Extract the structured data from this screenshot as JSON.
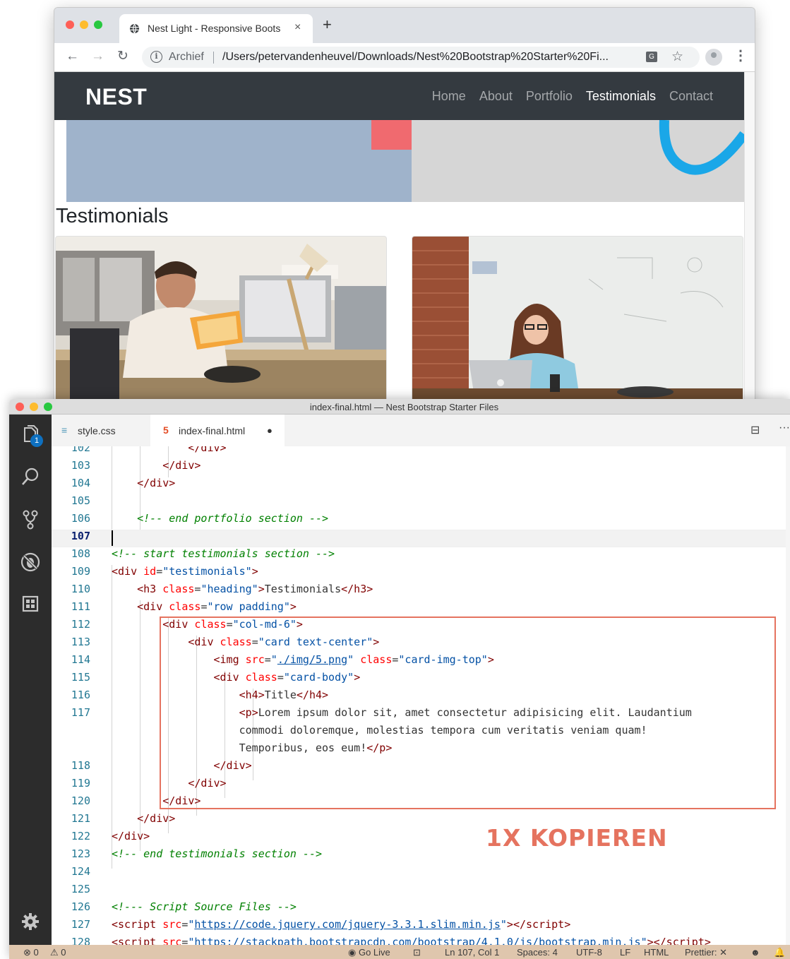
{
  "browser": {
    "tab_title": "Nest Light - Responsive Boots",
    "tab_close": "×",
    "new_tab": "+",
    "omnibox_label": "Archief",
    "url": "/Users/petervandenheuvel/Downloads/Nest%20Bootstrap%20Starter%20Fi...",
    "info_glyph": "i",
    "translate_glyph": "G",
    "star_glyph": "☆",
    "menu_glyph": "⋮"
  },
  "site": {
    "brand": "NEST",
    "nav": [
      "Home",
      "About",
      "Portfolio",
      "Testimonials",
      "Contact"
    ],
    "active_nav": "Testimonials",
    "heading": "Testimonials"
  },
  "vscode": {
    "window_title": "index-final.html — Nest Bootstrap Starter Files",
    "explorer_badge": "1",
    "tabs": [
      {
        "icon": "≡",
        "name": "style.css",
        "active": false
      },
      {
        "icon": "5",
        "name": "index-final.html",
        "active": true,
        "modified_marker": "●"
      }
    ],
    "editor_actions": [
      "⊟",
      "···"
    ],
    "current_line": "107",
    "lines": [
      {
        "num": "102",
        "html": "            &lt;/div&gt;"
      },
      {
        "num": "103",
        "html": "        &lt;/div&gt;"
      },
      {
        "num": "104",
        "html": "    &lt;/div&gt;"
      },
      {
        "num": "105",
        "html": ""
      },
      {
        "num": "106",
        "html": "    &lt;!-- end portfolio section --&gt;"
      },
      {
        "num": "107",
        "html": ""
      },
      {
        "num": "108",
        "html": "&lt;!-- start testimonials section --&gt;"
      },
      {
        "num": "109",
        "html": "&lt;div id=\"testimonials\"&gt;"
      },
      {
        "num": "110",
        "html": "    &lt;h3 class=\"heading\"&gt;Testimonials&lt;/h3&gt;"
      },
      {
        "num": "111",
        "html": "    &lt;div class=\"row padding\"&gt;"
      },
      {
        "num": "112",
        "html": "        &lt;div class=\"col-md-6\"&gt;"
      },
      {
        "num": "113",
        "html": "            &lt;div class=\"card text-center\"&gt;"
      },
      {
        "num": "114",
        "html": "                &lt;img src=\"./img/5.png\" class=\"card-img-top\"&gt;"
      },
      {
        "num": "115",
        "html": "                &lt;div class=\"card-body\"&gt;"
      },
      {
        "num": "116",
        "html": "                    &lt;h4&gt;Title&lt;/h4&gt;"
      },
      {
        "num": "117",
        "html": "                    &lt;p&gt;Lorem ipsum dolor sit, amet consectetur adipisicing elit. Laudantium"
      },
      {
        "num": "",
        "html": "                    commodi doloremque, molestias tempora cum veritatis veniam quam!"
      },
      {
        "num": "",
        "html": "                    Temporibus, eos eum!&lt;/p&gt;"
      },
      {
        "num": "118",
        "html": "                &lt;/div&gt;"
      },
      {
        "num": "119",
        "html": "            &lt;/div&gt;"
      },
      {
        "num": "120",
        "html": "        &lt;/div&gt;"
      },
      {
        "num": "121",
        "html": "    &lt;/div&gt;"
      },
      {
        "num": "122",
        "html": "&lt;/div&gt;"
      },
      {
        "num": "123",
        "html": "&lt;!-- end testimonials section --&gt;"
      },
      {
        "num": "124",
        "html": ""
      },
      {
        "num": "125",
        "html": ""
      },
      {
        "num": "126",
        "html": "&lt;!--- Script Source Files --&gt;"
      },
      {
        "num": "127",
        "html": "&lt;script src=\"https://code.jquery.com/jquery-3.3.1.slim.min.js\"&gt;&lt;/script&gt;"
      },
      {
        "num": "128",
        "html": "&lt;script src=\"https://stackpath.bootstrapcdn.com/bootstrap/4.1.0/js/bootstrap.min.js\"&gt;&lt;/script&gt;"
      }
    ],
    "annotation": "1X KOPIEREN",
    "status": {
      "errors": "⊗ 0",
      "warnings": "⚠ 0",
      "go_live": "Go Live",
      "position": "Ln 107, Col 1",
      "spaces": "Spaces: 4",
      "encoding": "UTF-8",
      "eol": "LF",
      "language": "HTML",
      "prettier": "Prettier: ✕"
    }
  }
}
